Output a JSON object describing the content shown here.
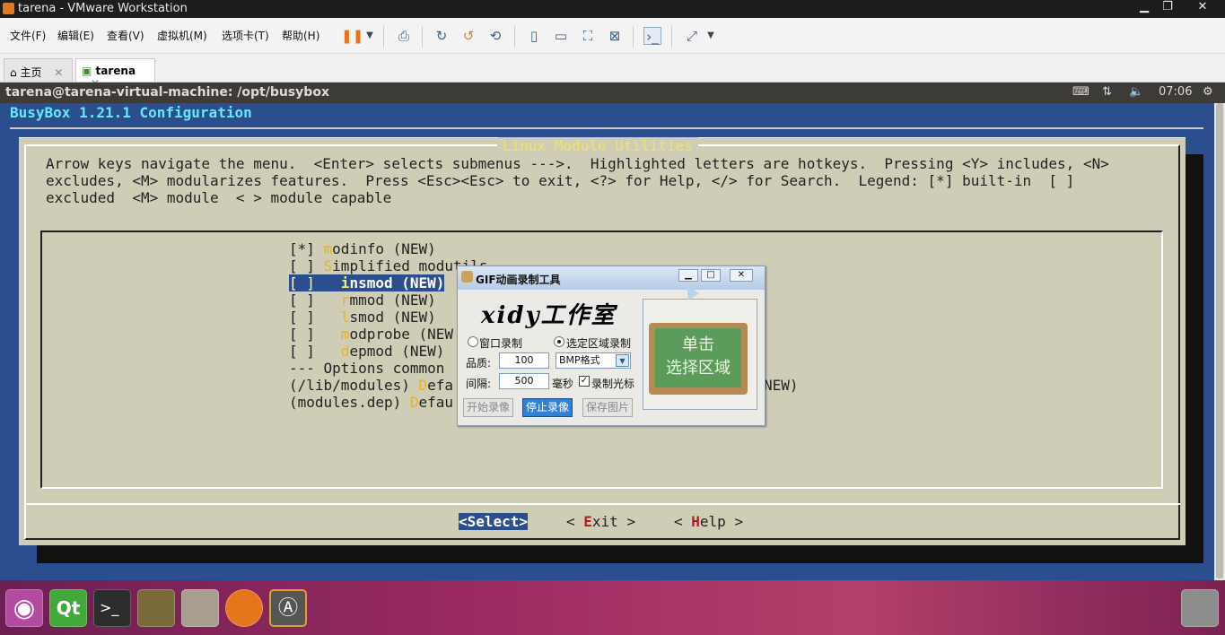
{
  "window": {
    "title": "tarena - VMware Workstation"
  },
  "menu": [
    "文件(F)",
    "编辑(E)",
    "查看(V)",
    "虚拟机(M)",
    "选项卡(T)",
    "帮助(H)"
  ],
  "tabs": [
    {
      "label": "主页",
      "close": "✕"
    },
    {
      "label": "tarena",
      "close": "✕"
    }
  ],
  "ubuntu_panel": {
    "title": "tarena@tarena-virtual-machine: /opt/busybox",
    "time": "07:06"
  },
  "term": {
    "title": "BusyBox 1.21.1 Configuration",
    "dialog_title": "Linux Module Utilities",
    "help_lines": [
      "Arrow keys navigate the menu.  <Enter> selects submenus --->.  Highlighted letters are hotkeys.  Pressing <Y> includes, <N>",
      "excludes, <M> modularizes features.  Press <Esc><Esc> to exit, <?> for Help, </> for Search.  Legend: [*] built-in  [ ]",
      "excluded  <M> module  < > module capable"
    ],
    "items": [
      {
        "pre": "[*] ",
        "hot": "m",
        "rest": "odinfo (NEW)"
      },
      {
        "pre": "[ ] ",
        "hot": "S",
        "rest": "implified modutils"
      },
      {
        "pre": "[ ]   ",
        "hot": "i",
        "rest": "nsmod (NEW)"
      },
      {
        "pre": "[ ]   ",
        "hot": "r",
        "rest": "mmod (NEW)"
      },
      {
        "pre": "[ ]   ",
        "hot": "l",
        "rest": "smod (NEW)"
      },
      {
        "pre": "[ ]   ",
        "hot": "m",
        "rest": "odprobe (NEW"
      },
      {
        "pre": "[ ]   ",
        "hot": "d",
        "rest": "epmod (NEW)"
      },
      {
        "pre": "--- Options common ",
        "hot": "",
        "rest": ""
      },
      {
        "pre": "(/lib/modules) ",
        "hot": "D",
        "rest": "efa"
      },
      {
        "pre": "(modules.dep) ",
        "hot": "D",
        "rest": "efau"
      }
    ],
    "items_tail": "NEW)",
    "buttons": {
      "select": "<Select>",
      "exit_pre": "< ",
      "exit_key": "E",
      "exit_rest": "xit >",
      "help_pre": "< ",
      "help_key": "H",
      "help_rest": "elp >"
    }
  },
  "gif_tool": {
    "title": "GIF动画录制工具",
    "logo": "xidy工作室",
    "mode_window": "窗口录制",
    "mode_region": "选定区域录制",
    "quality_label": "品质:",
    "quality_value": "100",
    "format_value": "BMP格式",
    "interval_label": "间隔:",
    "interval_value": "500",
    "interval_unit": "毫秒",
    "record_cursor": "录制光标",
    "btn_start": "开始录像",
    "btn_stop": "停止录像",
    "btn_save": "保存图片",
    "board_line1": "单击",
    "board_line2": "选择区域"
  },
  "launcher": [
    "ubuntu-dash-icon",
    "qt-creator-icon",
    "terminal-icon",
    "book-icon",
    "file-manager-icon",
    "firefox-icon",
    "updater-icon",
    "trash-icon"
  ]
}
